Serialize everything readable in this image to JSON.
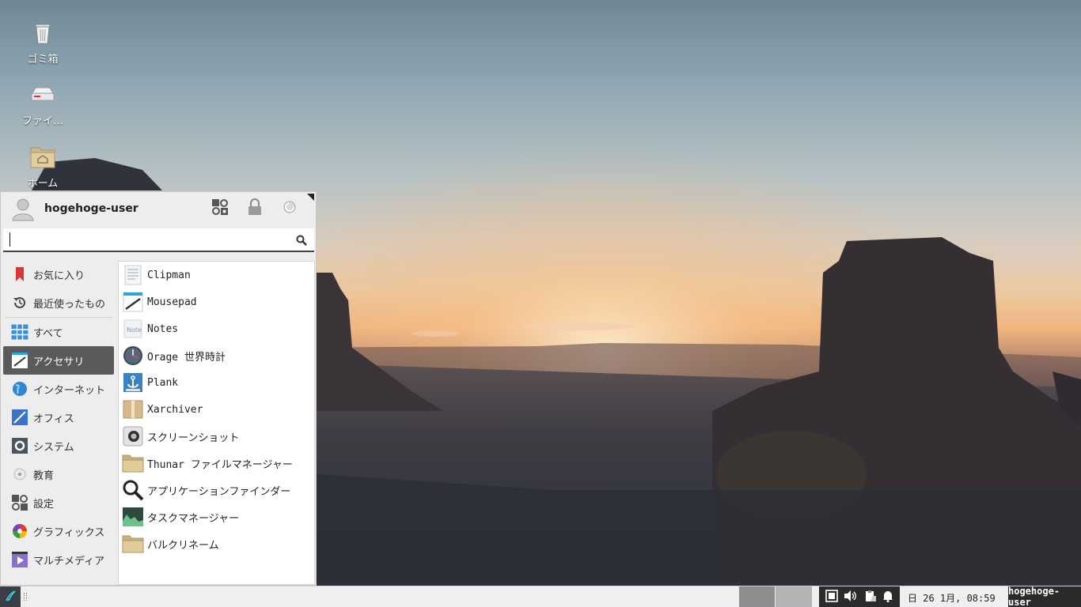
{
  "desktop": {
    "icons": [
      {
        "label": "ゴミ箱",
        "icon": "trash-icon"
      },
      {
        "label": "ファイ…",
        "icon": "drive-icon"
      },
      {
        "label": "ホーム",
        "icon": "home-folder-icon"
      }
    ]
  },
  "menu": {
    "username": "hogehoge-user",
    "header_buttons": [
      "settings-manager-icon",
      "lock-screen-icon",
      "logout-icon"
    ],
    "search": {
      "value": "",
      "placeholder": ""
    },
    "categories": [
      {
        "label": "お気に入り",
        "icon": "bookmark-icon",
        "active": false
      },
      {
        "label": "最近使ったもの",
        "icon": "history-icon",
        "active": false
      },
      {
        "label": "すべて",
        "icon": "grid-icon",
        "active": false
      },
      {
        "label": "アクセサリ",
        "icon": "accessories-icon",
        "active": true
      },
      {
        "label": "インターネット",
        "icon": "globe-icon",
        "active": false
      },
      {
        "label": "オフィス",
        "icon": "office-icon",
        "active": false
      },
      {
        "label": "システム",
        "icon": "system-icon",
        "active": false
      },
      {
        "label": "教育",
        "icon": "education-icon",
        "active": false
      },
      {
        "label": "設定",
        "icon": "settings-icon",
        "active": false
      },
      {
        "label": "グラフィックス",
        "icon": "graphics-icon",
        "active": false
      },
      {
        "label": "マルチメディア",
        "icon": "multimedia-icon",
        "active": false
      }
    ],
    "apps": [
      {
        "label": "Clipman",
        "icon": "clipboard-icon"
      },
      {
        "label": "Mousepad",
        "icon": "text-editor-icon"
      },
      {
        "label": "Notes",
        "icon": "notes-icon"
      },
      {
        "label": "Orage 世界時計",
        "icon": "clock-icon"
      },
      {
        "label": "Plank",
        "icon": "anchor-icon"
      },
      {
        "label": "Xarchiver",
        "icon": "archive-box-icon"
      },
      {
        "label": "スクリーンショット",
        "icon": "camera-icon"
      },
      {
        "label": "Thunar ファイルマネージャー",
        "icon": "folder-icon"
      },
      {
        "label": "アプリケーションファインダー",
        "icon": "magnifier-icon"
      },
      {
        "label": "タスクマネージャー",
        "icon": "task-graph-icon"
      },
      {
        "label": "バルクリネーム",
        "icon": "folder-icon"
      }
    ]
  },
  "taskbar": {
    "clock": "日 26  1月, 08:59",
    "user": "hogehoge-user",
    "tray_icons": [
      "network-icon",
      "volume-icon",
      "clipboard-tray-icon",
      "notification-bell-icon"
    ],
    "colors": {
      "panel": "#efefef",
      "tray": "#2b2b2b",
      "active_category": "#5a5a5a"
    }
  }
}
